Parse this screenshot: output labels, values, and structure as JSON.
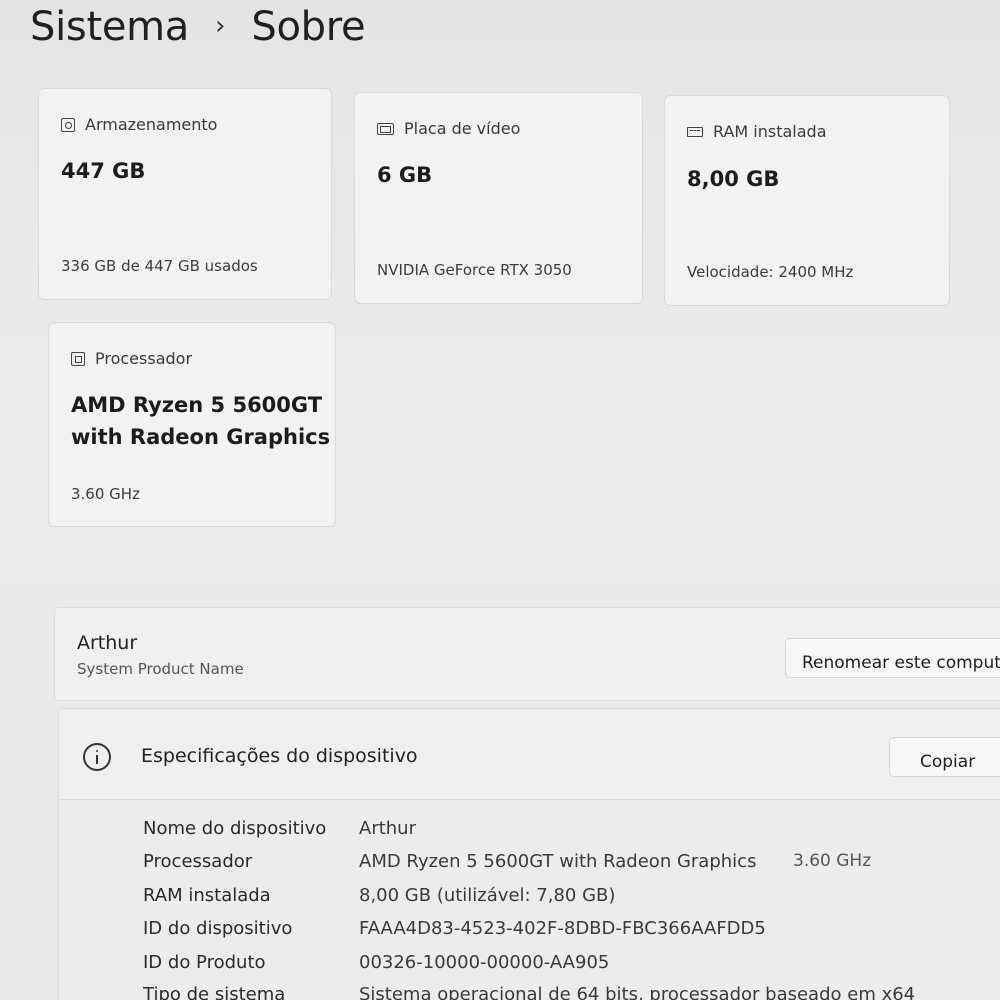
{
  "breadcrumb": {
    "parent": "Sistema",
    "separator": "›",
    "current": "Sobre"
  },
  "cards": {
    "storage": {
      "icon": "storage-icon",
      "label": "Armazenamento",
      "value": "447 GB",
      "detail": "336 GB de 447 GB usados"
    },
    "gpu": {
      "icon": "graphics-card-icon",
      "label": "Placa de vídeo",
      "value": "6 GB",
      "detail": "NVIDIA GeForce RTX 3050"
    },
    "ram": {
      "icon": "memory-icon",
      "label": "RAM instalada",
      "value": "8,00 GB",
      "detail": "Velocidade: 2400 MHz"
    },
    "cpu": {
      "icon": "processor-icon",
      "label": "Processador",
      "value_line1": "AMD Ryzen 5 5600GT",
      "value_line2": "with Radeon Graphics",
      "detail": "3.60 GHz"
    }
  },
  "device": {
    "name": "Arthur",
    "model": "System Product Name",
    "rename_button": "Renomear este computador"
  },
  "specs": {
    "icon": "info-icon",
    "title": "Especificações do dispositivo",
    "copy_button": "Copiar",
    "rows": [
      {
        "key": "Nome do dispositivo",
        "value": "Arthur"
      },
      {
        "key": "Processador",
        "value": "AMD Ryzen 5 5600GT with Radeon Graphics",
        "extra": "3.60 GHz"
      },
      {
        "key": "RAM instalada",
        "value": "8,00 GB (utilizável: 7,80 GB)"
      },
      {
        "key": "ID do dispositivo",
        "value": "FAAA4D83-4523-402F-8DBD-FBC366AAFDD5"
      },
      {
        "key": "ID do Produto",
        "value": "00326-10000-00000-AA905"
      },
      {
        "key": "Tipo de sistema",
        "value": "Sistema operacional de 64 bits, processador baseado em x64"
      }
    ]
  }
}
